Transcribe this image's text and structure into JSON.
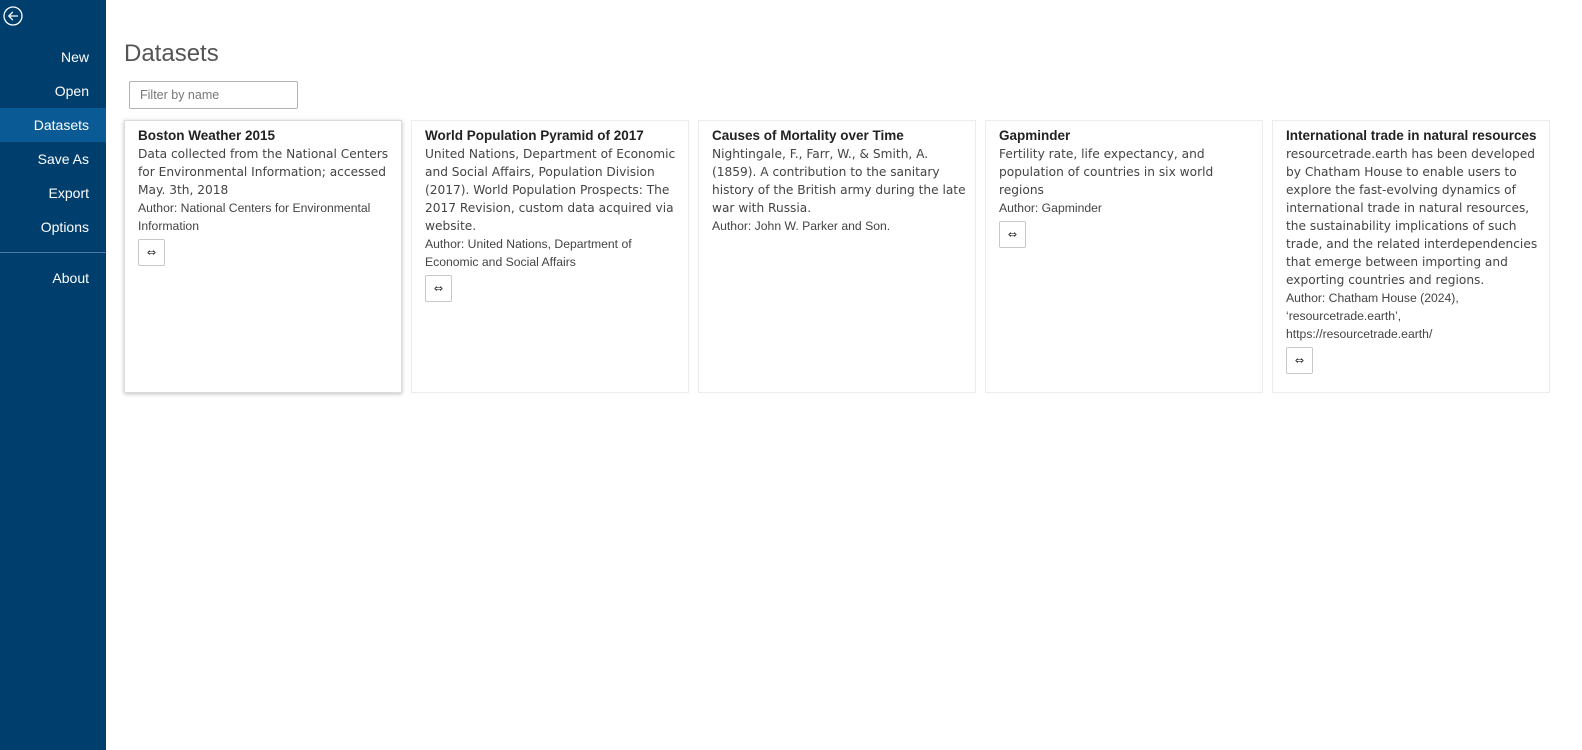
{
  "sidebar": {
    "back_icon": "back-arrow-circle-icon",
    "items": [
      {
        "id": "new",
        "label": "New"
      },
      {
        "id": "open",
        "label": "Open"
      },
      {
        "id": "datasets",
        "label": "Datasets",
        "active": true
      },
      {
        "id": "save-as",
        "label": "Save As"
      },
      {
        "id": "export",
        "label": "Export"
      },
      {
        "id": "options",
        "label": "Options"
      }
    ],
    "footer_items": [
      {
        "id": "about",
        "label": "About"
      }
    ],
    "colors": {
      "background": "#003e6d",
      "active": "#0a5a96"
    }
  },
  "main": {
    "title": "Datasets",
    "filter": {
      "placeholder": "Filter by name",
      "value": ""
    },
    "datasets": [
      {
        "title": "Boston Weather 2015",
        "description": "Data collected from the National Centers for Environmental Information; accessed May. 3th, 2018",
        "author": "Author: National Centers for Environmental Information",
        "has_link": true,
        "link_icon": "link-icon",
        "link_glyph": "⇔"
      },
      {
        "title": "World Population Pyramid of 2017",
        "description": "United Nations, Department of Economic and Social Affairs, Population Division (2017). World Population Prospects: The 2017 Revision, custom data acquired via website.",
        "author": "Author: United Nations, Department of Economic and Social Affairs",
        "has_link": true,
        "link_icon": "link-icon",
        "link_glyph": "⇔"
      },
      {
        "title": "Causes of Mortality over Time",
        "description": "Nightingale, F., Farr, W., & Smith, A. (1859). A contribution to the sanitary history of the British army during the late war with Russia.",
        "author": "Author: John W. Parker and Son.",
        "has_link": false
      },
      {
        "title": "Gapminder",
        "description": "Fertility rate, life expectancy, and population of countries in six world regions",
        "author": "Author: Gapminder",
        "has_link": true,
        "link_icon": "link-icon",
        "link_glyph": "⇔"
      },
      {
        "title": "International trade in natural resources",
        "description": "resourcetrade.earth has been developed by Chatham House to enable users to explore the fast-evolving dynamics of international trade in natural resources, the sustainability implications of such trade, and the related interdependencies that emerge between importing and exporting countries and regions.",
        "author": "Author: Chatham House (2024), ‘resourcetrade.earth’, https://resourcetrade.earth/",
        "has_link": true,
        "link_icon": "link-icon",
        "link_glyph": "⇔"
      }
    ]
  }
}
